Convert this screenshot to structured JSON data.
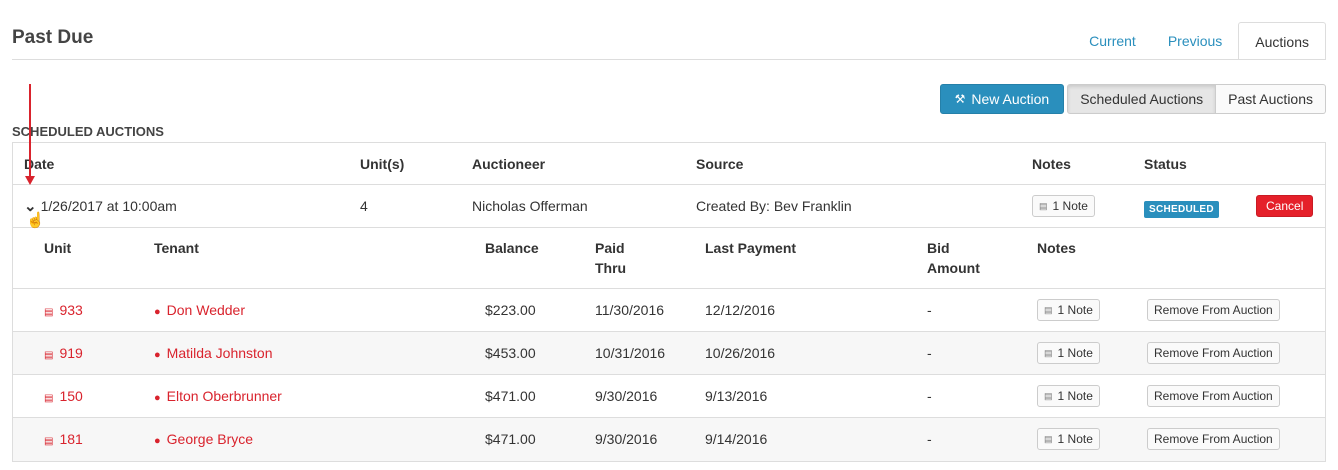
{
  "page": {
    "title": "Past Due"
  },
  "tabs": [
    {
      "label": "Current",
      "active": false
    },
    {
      "label": "Previous",
      "active": false
    },
    {
      "label": "Auctions",
      "active": true
    }
  ],
  "toolbar": {
    "new_auction_label": "New Auction",
    "scheduled_label": "Scheduled Auctions",
    "past_label": "Past Auctions"
  },
  "section": {
    "title": "SCHEDULED AUCTIONS"
  },
  "auction_table": {
    "headers": {
      "date": "Date",
      "units": "Unit(s)",
      "auctioneer": "Auctioneer",
      "source": "Source",
      "notes": "Notes",
      "status": "Status"
    },
    "auction": {
      "date": "1/26/2017 at 10:00am",
      "units": "4",
      "auctioneer": "Nicholas Offerman",
      "source": "Created By: Bev Franklin",
      "notes": "1 Note",
      "status": "SCHEDULED",
      "cancel": "Cancel"
    }
  },
  "units_table": {
    "headers": {
      "unit": "Unit",
      "tenant": "Tenant",
      "balance": "Balance",
      "paid_thru_1": "Paid",
      "paid_thru_2": "Thru",
      "last_payment": "Last Payment",
      "bid_1": "Bid",
      "bid_2": "Amount",
      "notes": "Notes"
    },
    "rows": [
      {
        "unit": "933",
        "tenant": "Don Wedder",
        "balance": "$223.00",
        "paid_thru": "11/30/2016",
        "last_payment": "12/12/2016",
        "bid": "-",
        "notes": "1 Note",
        "action": "Remove From Auction"
      },
      {
        "unit": "919",
        "tenant": "Matilda Johnston",
        "balance": "$453.00",
        "paid_thru": "10/31/2016",
        "last_payment": "10/26/2016",
        "bid": "-",
        "notes": "1 Note",
        "action": "Remove From Auction"
      },
      {
        "unit": "150",
        "tenant": "Elton Oberbrunner",
        "balance": "$471.00",
        "paid_thru": "9/30/2016",
        "last_payment": "9/13/2016",
        "bid": "-",
        "notes": "1 Note",
        "action": "Remove From Auction"
      },
      {
        "unit": "181",
        "tenant": "George Bryce",
        "balance": "$471.00",
        "paid_thru": "9/30/2016",
        "last_payment": "9/14/2016",
        "bid": "-",
        "notes": "1 Note",
        "action": "Remove From Auction"
      }
    ]
  },
  "icons": {
    "gavel": "gavel-icon",
    "note": "note-icon",
    "unit": "storage-unit-icon",
    "person": "person-icon",
    "chevron": "chevron-down-icon"
  },
  "colors": {
    "accent": "#2a8fbd",
    "danger": "#e5202a",
    "link_red": "#d9232d"
  }
}
